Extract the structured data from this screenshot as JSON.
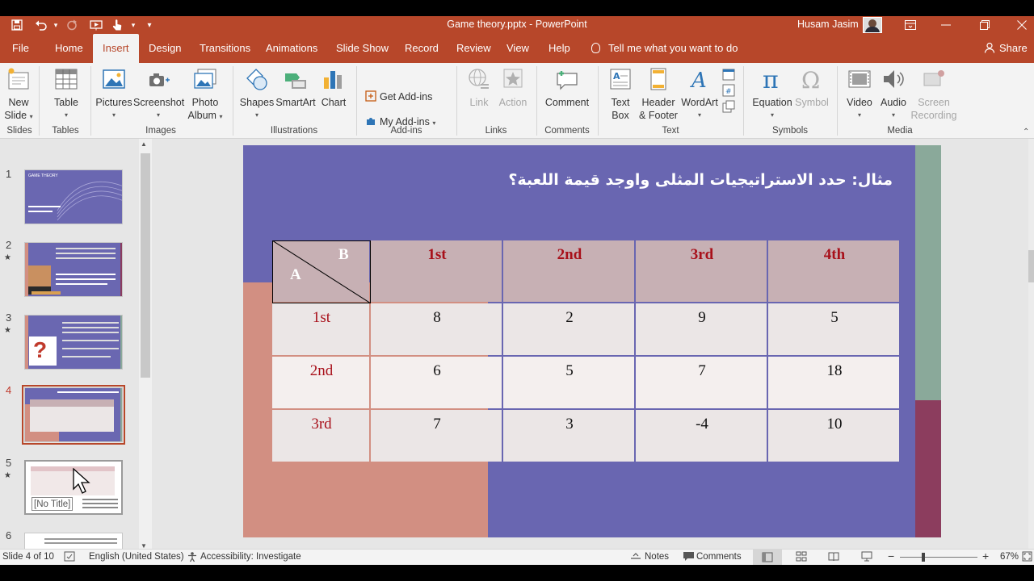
{
  "window": {
    "doc_title": "Game theory.pptx",
    "app_name": "PowerPoint",
    "separator": "-",
    "user_name": "Husam Jasim"
  },
  "menu": {
    "tabs": [
      "File",
      "Home",
      "Insert",
      "Design",
      "Transitions",
      "Animations",
      "Slide Show",
      "Record",
      "Review",
      "View",
      "Help"
    ],
    "active_tab": "Insert",
    "tell_me": "Tell me what you want to do",
    "share": "Share"
  },
  "ribbon": {
    "new_slide_1": "New",
    "new_slide_2": "Slide",
    "table": "Table",
    "pictures": "Pictures",
    "screenshot": "Screenshot",
    "photo_album_1": "Photo",
    "photo_album_2": "Album",
    "shapes": "Shapes",
    "smartart": "SmartArt",
    "chart": "Chart",
    "get_addins": "Get Add-ins",
    "my_addins": "My Add-ins",
    "link": "Link",
    "action": "Action",
    "comment": "Comment",
    "text_box_1": "Text",
    "text_box_2": "Box",
    "header_footer_1": "Header",
    "header_footer_2": "& Footer",
    "wordart": "WordArt",
    "equation": "Equation",
    "symbol": "Symbol",
    "video": "Video",
    "audio": "Audio",
    "screen_rec_1": "Screen",
    "screen_rec_2": "Recording",
    "groups": {
      "slides": "Slides",
      "tables": "Tables",
      "images": "Images",
      "illustrations": "Illustrations",
      "addins": "Add-ins",
      "links": "Links",
      "comments": "Comments",
      "text": "Text",
      "symbols": "Symbols",
      "media": "Media"
    }
  },
  "thumbnails": {
    "numbers": [
      "1",
      "2",
      "3",
      "4",
      "5",
      "6"
    ],
    "star": "★",
    "thumb1_line1": "GAME THEORY",
    "thumb5_tooltip": "[No Title]"
  },
  "slide": {
    "title": "مثال:  حدد الاستراتيجيات المثلى واوجد قيمة اللعبة؟",
    "corner_a": "A",
    "corner_b": "B",
    "col_headers": [
      "1st",
      "2nd",
      "3rd",
      "4th"
    ],
    "row_headers": [
      "1st",
      "2nd",
      "3rd"
    ],
    "values": [
      [
        "8",
        "2",
        "9",
        "5"
      ],
      [
        "6",
        "5",
        "7",
        "18"
      ],
      [
        "7",
        "3",
        "-4",
        "10"
      ]
    ],
    "colors": {
      "background": "#6966b1",
      "salmon": "#d28f82",
      "green": "#8aa99a",
      "maroon": "#8c3d5e",
      "header_cell": "#c7b0b4",
      "label_red": "#a8101a"
    }
  },
  "statusbar": {
    "slide_info": "Slide 4 of 10",
    "language": "English (United States)",
    "accessibility": "Accessibility: Investigate",
    "notes": "Notes",
    "comments": "Comments",
    "zoom": "67%",
    "minus": "−",
    "plus": "+"
  }
}
